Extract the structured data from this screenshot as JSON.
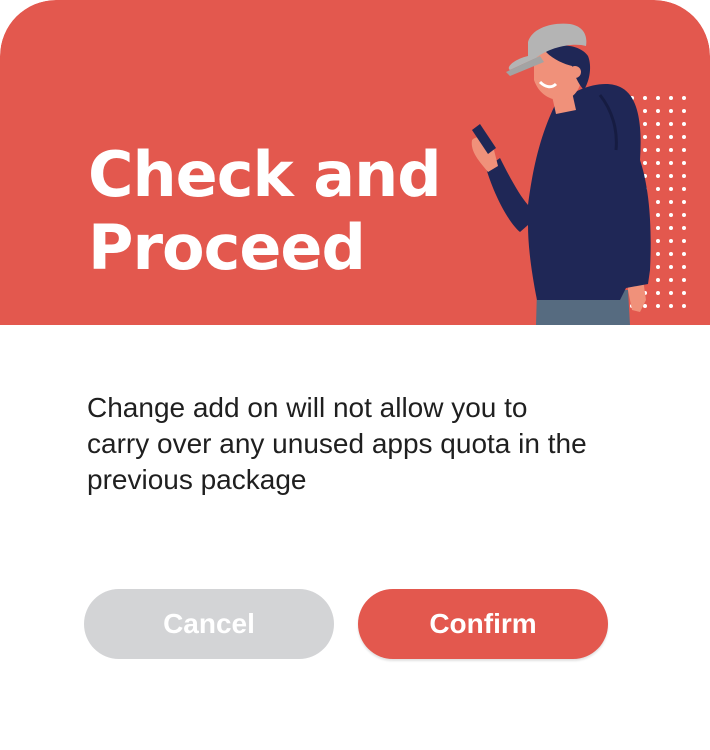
{
  "dialog": {
    "title": "Check and Proceed",
    "message": "Change add on will not allow you to carry over any unused apps quota in the previous package",
    "cancel_label": "Cancel",
    "confirm_label": "Confirm"
  },
  "colors": {
    "accent": "#e3584e",
    "cancel_button": "#d3d4d6",
    "hoodie": "#1f2756",
    "cap": "#b4b4b4",
    "skin": "#f0917a",
    "pants": "#566b80"
  },
  "icons": {
    "illustration": "person-with-phone-illustration"
  }
}
